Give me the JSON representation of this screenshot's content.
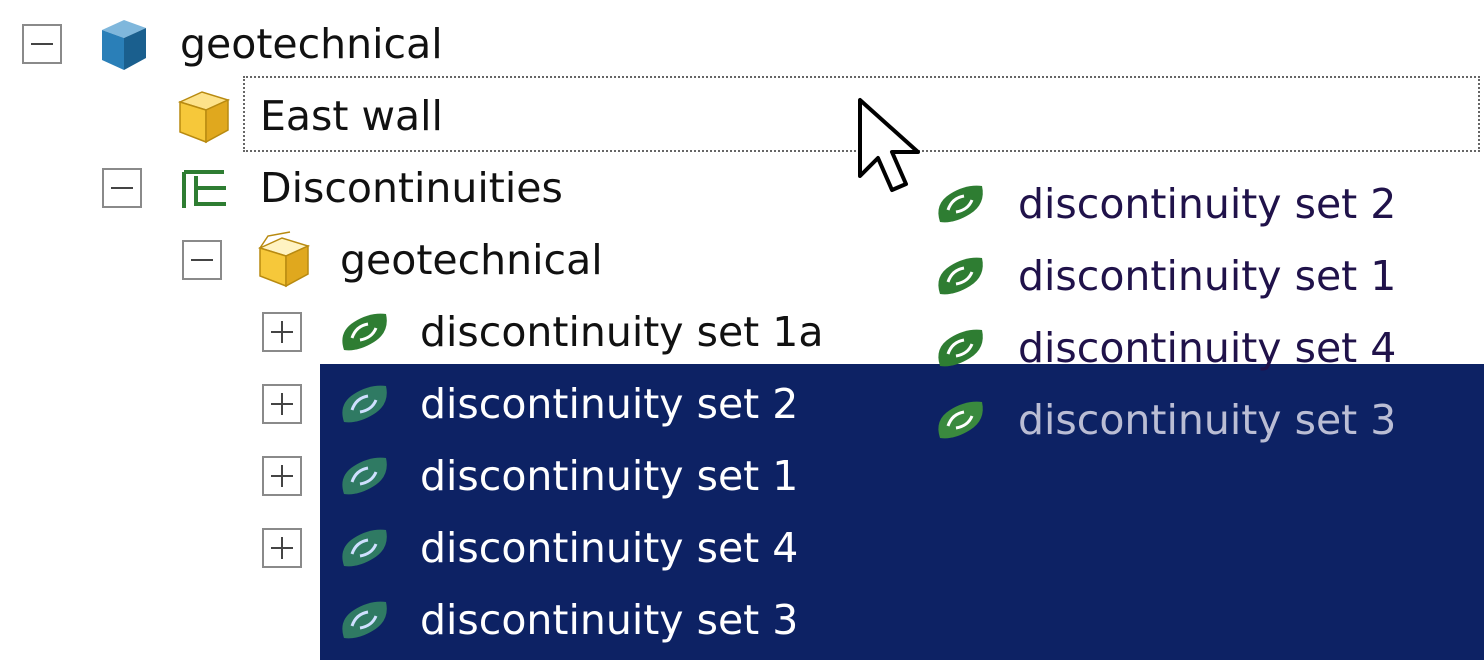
{
  "tree": {
    "root": {
      "label": "geotechnical",
      "expanded": true,
      "icon": "blue-cube-icon"
    },
    "east_wall": {
      "label": "East wall",
      "icon": "yellow-box-icon"
    },
    "discontinuities": {
      "label": "Discontinuities",
      "expanded": true,
      "icon": "discontinuity-folder-icon"
    },
    "sub_group": {
      "label": "geotechnical",
      "expanded": true,
      "icon": "yellow-open-box-icon"
    },
    "sets": [
      {
        "label": "discontinuity set 1a",
        "selected": false,
        "icon": "green-discontinuity-icon"
      },
      {
        "label": "discontinuity set 2",
        "selected": true,
        "icon": "green-discontinuity-icon"
      },
      {
        "label": "discontinuity set 1",
        "selected": true,
        "icon": "green-discontinuity-icon"
      },
      {
        "label": "discontinuity set 4",
        "selected": true,
        "icon": "green-discontinuity-icon"
      },
      {
        "label": "discontinuity set 3",
        "selected": true,
        "icon": "green-discontinuity-icon"
      }
    ]
  },
  "drag_preview": {
    "items": [
      {
        "label": "discontinuity set 2"
      },
      {
        "label": "discontinuity set 1"
      },
      {
        "label": "discontinuity set 4"
      },
      {
        "label": "discontinuity set 3"
      }
    ]
  },
  "colors": {
    "selection": "#0d2264",
    "icon_green": "#2e7d32",
    "cube_blue": "#1f6fa8",
    "box_yellow": "#f2c230"
  }
}
